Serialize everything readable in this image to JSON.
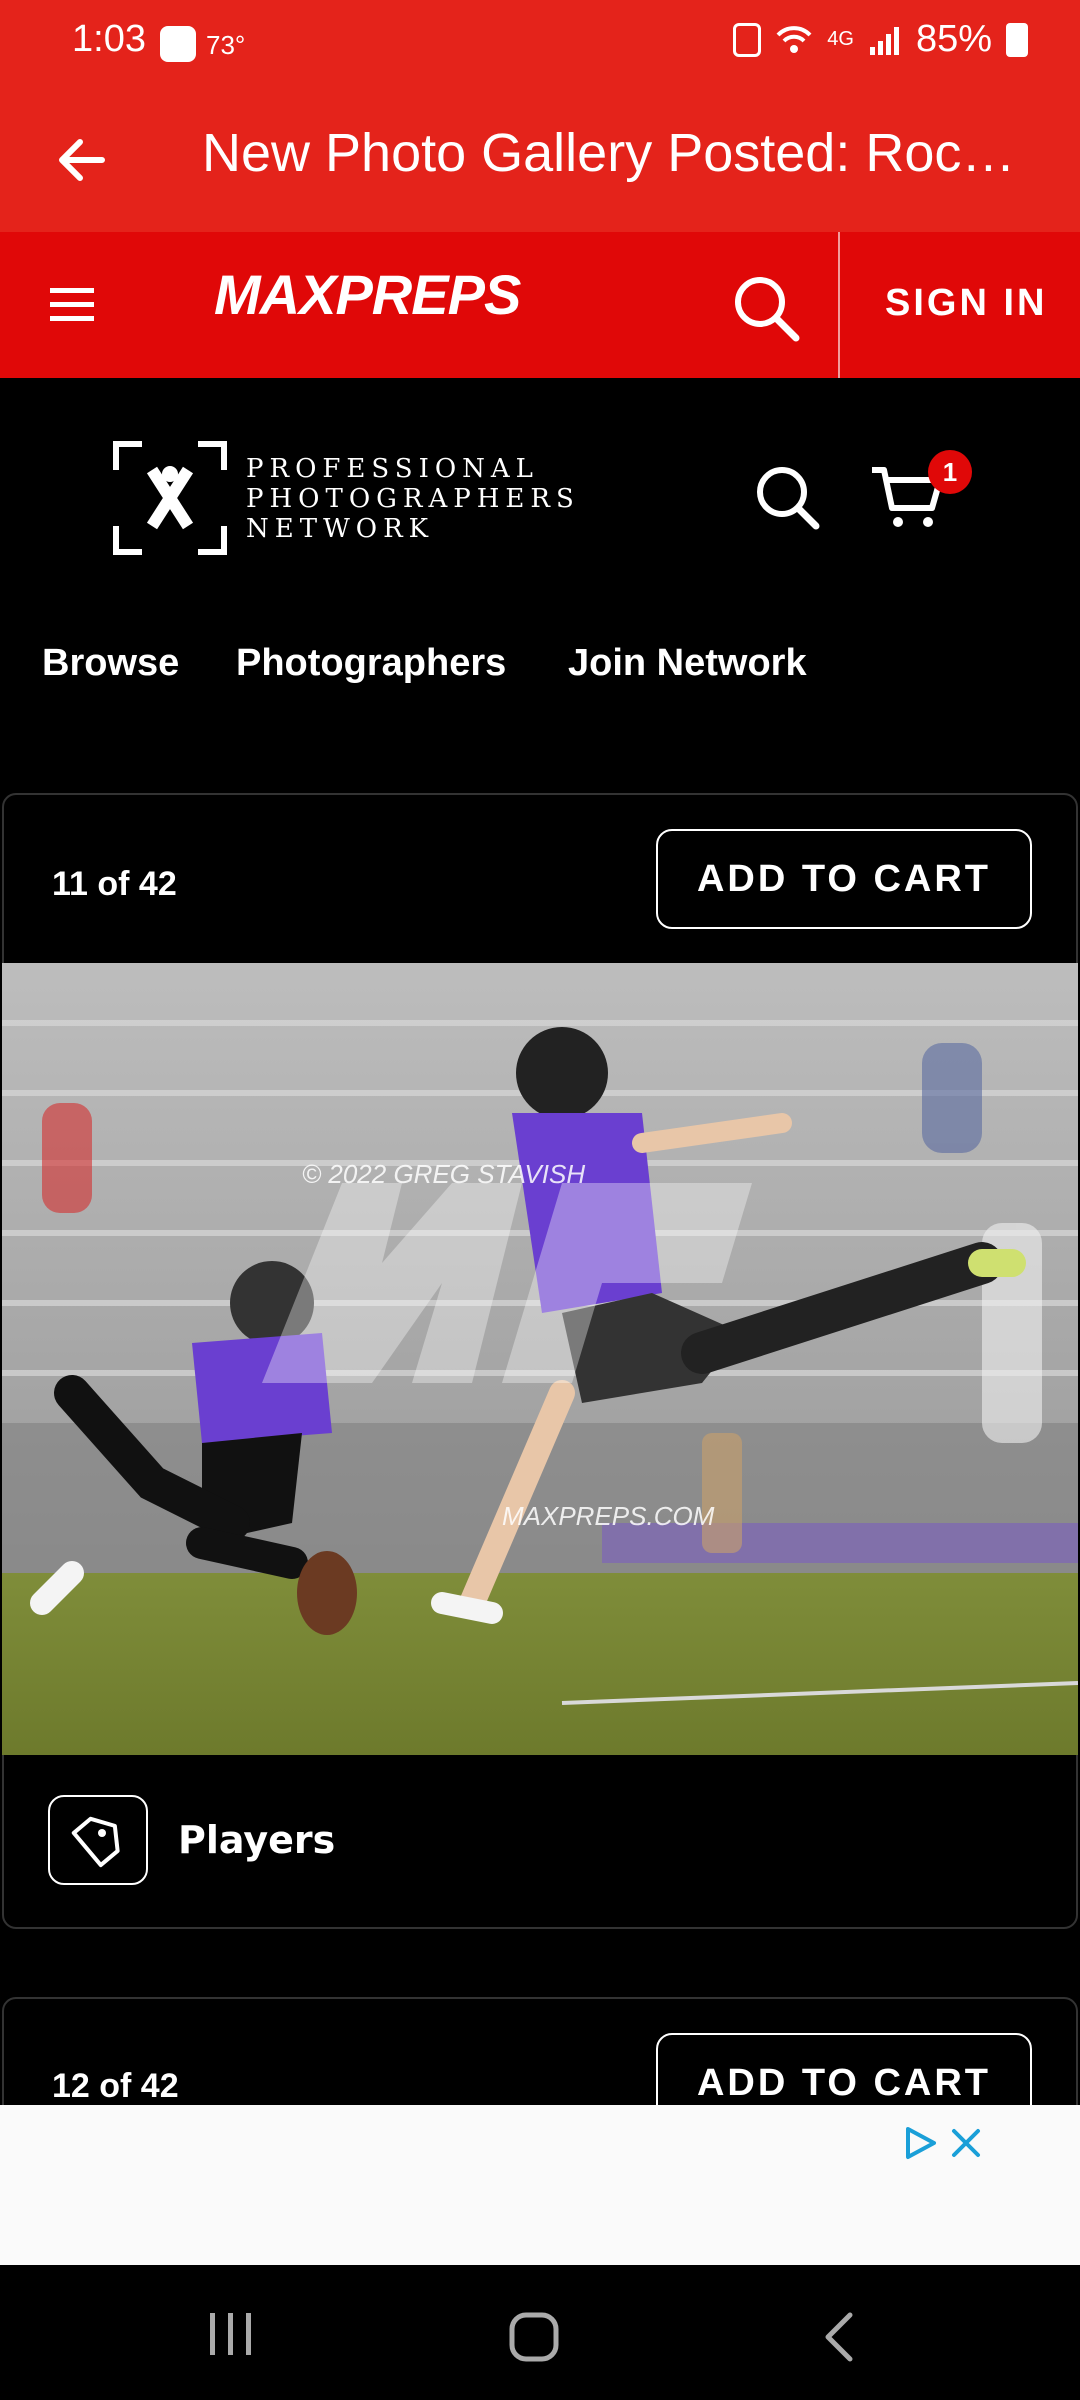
{
  "status_bar": {
    "time": "1:03",
    "temperature": "73°",
    "network": "4G",
    "battery": "85%"
  },
  "title_bar": {
    "title": "New Photo Gallery Posted: Rock…"
  },
  "maxpreps_header": {
    "logo_text": "MAXPREPS",
    "sign_in": "SIGN IN"
  },
  "photographers_network": {
    "logo_lines": [
      "PROFESSIONAL",
      "PHOTOGRAPHERS",
      "NETWORK"
    ],
    "cart_count": "1"
  },
  "nav": {
    "items": [
      "Browse",
      "Photographers",
      "Join Network"
    ]
  },
  "gallery": {
    "cards": [
      {
        "position": "11 of 42",
        "add_to_cart": "ADD TO CART",
        "tag_label": "Players",
        "watermark_credit": "© 2022 GREG STAVISH",
        "watermark_site": "MAXPREPS.COM"
      },
      {
        "position": "12 of 42",
        "add_to_cart": "ADD TO CART"
      }
    ]
  },
  "colors": {
    "status_red": "#e4231b",
    "brand_red": "#e00808",
    "background": "#000000",
    "jersey_purple": "#6a3fd0"
  }
}
